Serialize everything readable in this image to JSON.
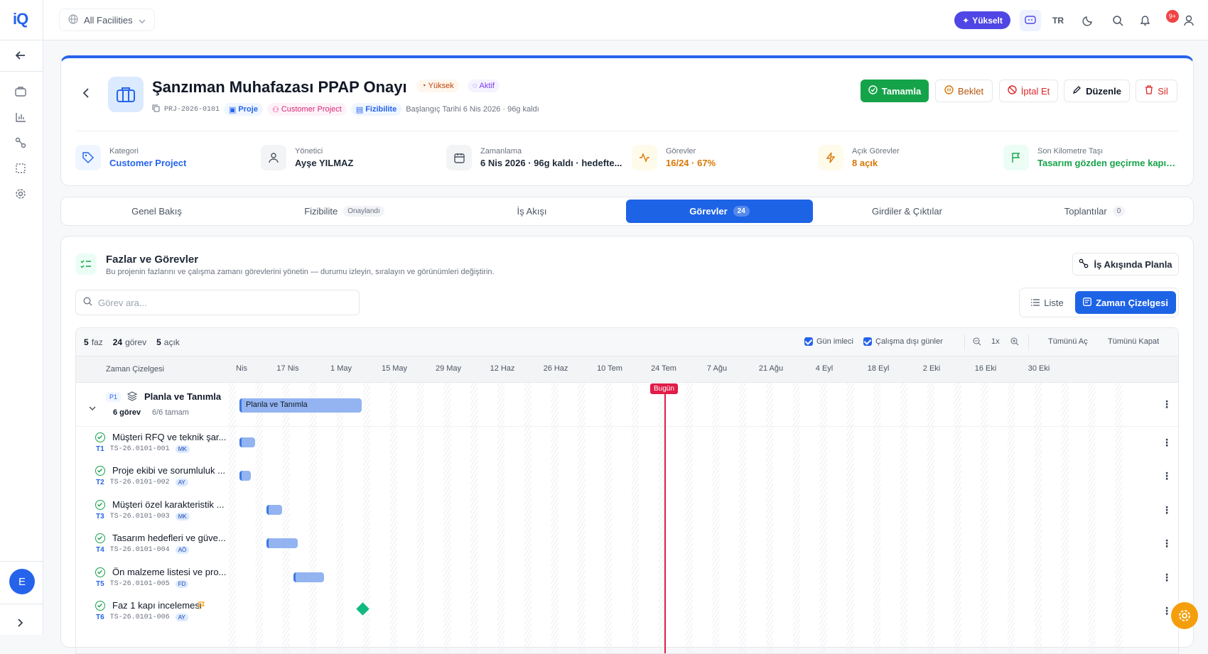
{
  "app": {
    "logo": "iQ",
    "user_initial": "E"
  },
  "topbar": {
    "facility": "All Facilities",
    "upgrade": "Yükselt",
    "language": "TR",
    "notif_count": "9+"
  },
  "project": {
    "title": "Şanzıman Muhafazası PPAP Onayı",
    "priority": "Yüksek",
    "status": "Aktif",
    "code": "PRJ-2026-0101",
    "type": "Proje",
    "category_tag": "Customer Project",
    "phase_tag": "Fizibilite",
    "start": "Başlangıç Tarihi 6 Nis 2026 · 96g kaldı"
  },
  "actions": {
    "complete": "Tamamla",
    "hold": "Beklet",
    "cancel": "İptal Et",
    "edit": "Düzenle",
    "delete": "Sil"
  },
  "stats": [
    {
      "label": "Kategori",
      "value": "Customer Project",
      "color": "#2563eb"
    },
    {
      "label": "Yönetici",
      "value": "Ayşe YILMAZ",
      "color": "#111827"
    },
    {
      "label": "Zamanlama",
      "value": "6 Nis 2026 · 96g kaldı · hedefte...",
      "color": "#111827"
    },
    {
      "label": "Görevler",
      "value": "16/24 · 67%",
      "color": "#d97706"
    },
    {
      "label": "Açık Görevler",
      "value": "8 açık",
      "color": "#d97706"
    },
    {
      "label": "Son Kilometre Taşı",
      "value": "Tasarım gözden geçirme kapısı...",
      "color": "#16a34a"
    }
  ],
  "tabs": [
    {
      "label": "Genel Bakış",
      "count": ""
    },
    {
      "label": "Fizibilite",
      "count": "Onaylandı"
    },
    {
      "label": "İş Akışı",
      "count": ""
    },
    {
      "label": "Görevler",
      "count": "24"
    },
    {
      "label": "Girdiler & Çıktılar",
      "count": ""
    },
    {
      "label": "Toplantılar",
      "count": "0"
    }
  ],
  "section": {
    "title": "Fazlar ve Görevler",
    "subtitle": "Bu projenin fazlarını ve çalışma zamanı görevlerini yönetin — durumu izleyin, sıralayın ve görünümleri değiştirin.",
    "plan_button": "İş Akışında Planla",
    "search_placeholder": "Görev ara...",
    "view_list": "Liste",
    "view_timeline": "Zaman Çizelgesi"
  },
  "gantt": {
    "summary": {
      "phases": "5",
      "phases_lbl": "faz",
      "tasks": "24",
      "tasks_lbl": "görev",
      "open": "5",
      "open_lbl": "açık"
    },
    "opt_today": "Gün imleci",
    "opt_nonwork": "Çalışma dışı günler",
    "zoom": "1x",
    "expand_all": "Tümünü Aç",
    "collapse_all": "Tümünü Kapat",
    "header_label": "Zaman Çizelgesi",
    "ticks": [
      "Nis",
      "17 Nis",
      "1 May",
      "15 May",
      "29 May",
      "12 Haz",
      "26 Haz",
      "10 Tem",
      "24 Tem",
      "7 Ağu",
      "21 Ağu",
      "4 Eyl",
      "18 Eyl",
      "2 Eki",
      "16 Eki",
      "30 Eki"
    ],
    "today_label": "Bugün",
    "phase": {
      "code": "P1",
      "name": "Planla ve Tanımla",
      "tasks": "6 görev",
      "done": "6/6 tamam",
      "bar_label": "Planla ve Tanımla"
    },
    "tasks": [
      {
        "id": "T1",
        "name": "Müşteri RFQ ve teknik şar...",
        "code": "TS-26.0101-001",
        "owner": "MK"
      },
      {
        "id": "T2",
        "name": "Proje ekibi ve sorumluluk ...",
        "code": "TS-26.0101-002",
        "owner": "AY"
      },
      {
        "id": "T3",
        "name": "Müşteri özel karakteristik ...",
        "code": "TS-26.0101-003",
        "owner": "MK"
      },
      {
        "id": "T4",
        "name": "Tasarım hedefleri ve güve...",
        "code": "TS-26.0101-004",
        "owner": "AÖ"
      },
      {
        "id": "T5",
        "name": "Ön malzeme listesi ve pro...",
        "code": "TS-26.0101-005",
        "owner": "FD"
      },
      {
        "id": "T6",
        "name": "Faz 1 kapı incelemesi",
        "code": "TS-26.0101-006",
        "owner": "AY"
      }
    ]
  }
}
